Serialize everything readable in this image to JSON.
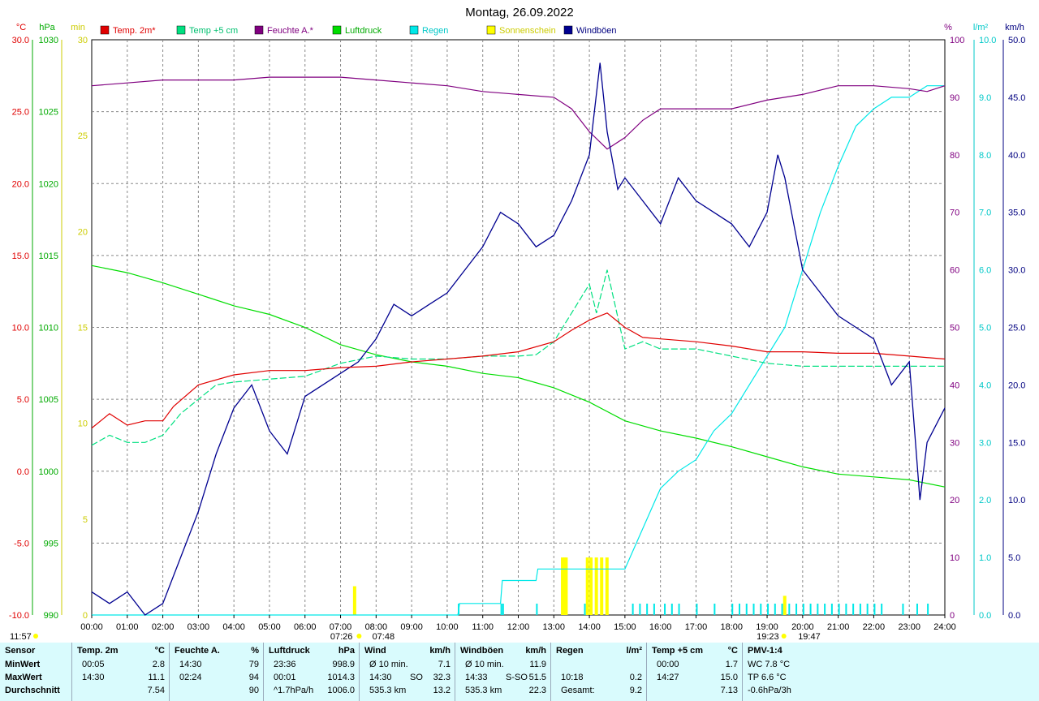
{
  "title": "Montag, 26.09.2022",
  "colors": {
    "temp2m": "#e00000",
    "temp5cm": "#00e080",
    "humidity": "#800080",
    "pressure": "#00dd00",
    "rain": "#00e8e8",
    "sunshine": "#ffff00",
    "gusts": "#000090"
  },
  "chart_data": {
    "type": "line",
    "title": "Montag, 26.09.2022",
    "x_ticks": [
      "00:00",
      "01:00",
      "02:00",
      "03:00",
      "04:00",
      "05:00",
      "06:00",
      "07:00",
      "08:00",
      "09:00",
      "10:00",
      "11:00",
      "12:00",
      "13:00",
      "14:00",
      "15:00",
      "16:00",
      "17:00",
      "18:00",
      "19:00",
      "20:00",
      "21:00",
      "22:00",
      "23:00",
      "24:00"
    ],
    "axes": {
      "temp": {
        "unit": "°C",
        "ticks": [
          "30.0",
          "25.0",
          "20.0",
          "15.0",
          "10.0",
          "5.0",
          "0.0",
          "-5.0",
          "-10.0"
        ],
        "range": [
          -10,
          30
        ]
      },
      "pressure": {
        "unit": "hPa",
        "ticks": [
          "1030",
          "1025",
          "1020",
          "1015",
          "1010",
          "1005",
          "1000",
          "995",
          "990"
        ],
        "range": [
          990,
          1030
        ]
      },
      "sunshine": {
        "unit": "min",
        "ticks": [
          "30",
          "25",
          "20",
          "15",
          "10",
          "5",
          "0"
        ],
        "range": [
          0,
          30
        ]
      },
      "humidity": {
        "unit": "%",
        "ticks": [
          "100",
          "90",
          "80",
          "70",
          "60",
          "50",
          "40",
          "30",
          "20",
          "10",
          "0"
        ],
        "range": [
          0,
          100
        ]
      },
      "rain": {
        "unit": "l/m²",
        "ticks": [
          "10.0",
          "9.0",
          "8.0",
          "7.0",
          "6.0",
          "5.0",
          "4.0",
          "3.0",
          "2.0",
          "1.0",
          "0.0"
        ],
        "range": [
          0,
          10
        ]
      },
      "wind": {
        "unit": "km/h",
        "ticks": [
          "50.0",
          "45.0",
          "40.0",
          "35.0",
          "30.0",
          "25.0",
          "20.0",
          "15.0",
          "10.0",
          "5.0",
          "0.0"
        ],
        "range": [
          0,
          50
        ]
      }
    },
    "legend": [
      "Temp. 2m*",
      "Temp +5 cm",
      "Feuchte A.*",
      "Luftdruck",
      "Regen",
      "Sonnenschein",
      "Windböen"
    ],
    "series": [
      {
        "name": "Temp. 2m*",
        "axis": "temp",
        "x": [
          0,
          0.5,
          1,
          1.5,
          2,
          2.3,
          3,
          4,
          5,
          6,
          7,
          8,
          9,
          10,
          11,
          12,
          13,
          13.5,
          14,
          14.5,
          15,
          15.5,
          16,
          17,
          18,
          19,
          20,
          21,
          22,
          23,
          24
        ],
        "y": [
          3.0,
          4.0,
          3.2,
          3.5,
          3.5,
          4.5,
          6.0,
          6.7,
          7.0,
          7.0,
          7.2,
          7.3,
          7.6,
          7.8,
          8.0,
          8.3,
          9.0,
          9.8,
          10.5,
          11.0,
          10.0,
          9.3,
          9.2,
          9.0,
          8.7,
          8.3,
          8.3,
          8.2,
          8.2,
          8.0,
          7.8
        ]
      },
      {
        "name": "Temp +5 cm",
        "axis": "temp",
        "x": [
          0,
          0.5,
          1,
          1.5,
          2,
          2.5,
          3,
          3.5,
          4,
          5,
          6,
          7,
          8,
          9,
          10,
          11,
          12,
          12.5,
          13,
          13.5,
          14,
          14.2,
          14.5,
          15,
          15.5,
          16,
          17,
          18,
          19,
          20,
          21,
          22,
          23,
          24
        ],
        "y": [
          1.8,
          2.5,
          2.0,
          2.0,
          2.5,
          4.0,
          5.0,
          6.0,
          6.2,
          6.4,
          6.6,
          7.5,
          8.0,
          7.8,
          7.8,
          8.0,
          8.0,
          8.1,
          9.0,
          11.0,
          13.0,
          11.0,
          14.0,
          8.5,
          9.0,
          8.5,
          8.5,
          8.0,
          7.5,
          7.3,
          7.3,
          7.3,
          7.3,
          7.3
        ]
      },
      {
        "name": "Feuchte A.*",
        "axis": "humidity",
        "x": [
          0,
          1,
          2,
          3,
          4,
          5,
          6,
          7,
          8,
          9,
          10,
          11,
          12,
          13,
          13.5,
          14,
          14.5,
          15,
          15.5,
          16,
          17,
          18,
          19,
          20,
          21,
          22,
          23,
          23.5,
          24
        ],
        "y": [
          92,
          92.5,
          93,
          93,
          93,
          93.5,
          93.5,
          93.5,
          93,
          92.5,
          92,
          91,
          90.5,
          90,
          88,
          84,
          81,
          83,
          86,
          88,
          88,
          88,
          89.5,
          90.5,
          92,
          92,
          91.5,
          91,
          92
        ]
      },
      {
        "name": "Luftdruck",
        "axis": "pressure",
        "x": [
          0,
          1,
          2,
          3,
          4,
          5,
          6,
          7,
          8,
          9,
          10,
          11,
          12,
          13,
          14,
          15,
          16,
          17,
          18,
          19,
          20,
          21,
          22,
          23,
          24
        ],
        "y": [
          1014.3,
          1013.8,
          1013.1,
          1012.3,
          1011.5,
          1010.9,
          1010.0,
          1008.8,
          1008.1,
          1007.6,
          1007.3,
          1006.8,
          1006.5,
          1005.8,
          1004.8,
          1003.5,
          1002.8,
          1002.3,
          1001.7,
          1001.0,
          1000.3,
          999.8,
          999.6,
          999.4,
          998.9
        ]
      },
      {
        "name": "Regen",
        "axis": "rain",
        "x": [
          0,
          10.3,
          10.35,
          11.5,
          11.55,
          12.5,
          12.55,
          13.8,
          13.85,
          15.0,
          15.5,
          16.0,
          16.5,
          17.0,
          17.5,
          18.0,
          18.5,
          19.0,
          19.5,
          20.0,
          20.5,
          21.0,
          21.5,
          22.0,
          22.5,
          23.0,
          23.5,
          24.0
        ],
        "y": [
          0,
          0,
          0.2,
          0.2,
          0.6,
          0.6,
          0.8,
          0.8,
          0.8,
          0.8,
          1.5,
          2.2,
          2.5,
          2.7,
          3.2,
          3.5,
          4.0,
          4.5,
          5.0,
          6.0,
          7.0,
          7.8,
          8.5,
          8.8,
          9.0,
          9.0,
          9.2,
          9.2
        ]
      },
      {
        "name": "Sonnenschein",
        "axis": "sunshine",
        "bars": [
          [
            7.35,
            1.5
          ],
          [
            13.2,
            3
          ],
          [
            13.25,
            3
          ],
          [
            13.3,
            3
          ],
          [
            13.9,
            3
          ],
          [
            14.0,
            3
          ],
          [
            14.15,
            3
          ],
          [
            14.3,
            3
          ],
          [
            14.45,
            3
          ],
          [
            19.45,
            1
          ]
        ]
      },
      {
        "name": "Windböen",
        "axis": "wind",
        "x": [
          0,
          0.5,
          1,
          1.5,
          2,
          2.5,
          3,
          3.5,
          4,
          4.5,
          5,
          5.5,
          6,
          6.5,
          7,
          7.5,
          8,
          8.5,
          9,
          9.5,
          10,
          10.5,
          11,
          11.5,
          12,
          12.5,
          13,
          13.5,
          14,
          14.3,
          14.5,
          14.8,
          15,
          15.5,
          16,
          16.5,
          17,
          17.5,
          18,
          18.5,
          19,
          19.3,
          19.5,
          20,
          20.5,
          21,
          21.5,
          22,
          22.5,
          23,
          23.3,
          23.5,
          24
        ],
        "y": [
          2,
          1,
          2,
          0,
          1,
          5,
          9,
          14,
          18,
          20,
          16,
          14,
          19,
          20,
          21,
          22,
          24,
          27,
          26,
          27,
          28,
          30,
          32,
          35,
          34,
          32,
          33,
          36,
          40,
          48,
          42,
          37,
          38,
          36,
          34,
          38,
          36,
          35,
          34,
          32,
          35,
          40,
          38,
          30,
          28,
          26,
          25,
          24,
          20,
          22,
          10,
          15,
          18
        ]
      }
    ],
    "rain_ticks_x": [
      10.3,
      11.5,
      11.55,
      12.5,
      13.85,
      15.2,
      15.4,
      15.6,
      15.8,
      16.1,
      16.3,
      16.5,
      17.0,
      17.5,
      18.0,
      18.2,
      18.4,
      18.6,
      18.8,
      19.0,
      19.2,
      19.4,
      19.6,
      19.8,
      20.0,
      20.2,
      20.4,
      20.6,
      20.8,
      21.0,
      21.2,
      21.4,
      21.6,
      21.8,
      22.0,
      22.2,
      22.8,
      23.2,
      23.5
    ],
    "sunrise": {
      "time": "07:26",
      "noon": "07:48"
    },
    "sunset": {
      "time": "19:23",
      "noon": "19:47"
    },
    "bottom_left_label": "11:57"
  },
  "stats": {
    "sensor": {
      "header": "Sensor",
      "rows": [
        "MinWert",
        "MaxWert",
        "Durchschnitt"
      ]
    },
    "temp2m": {
      "header": "Temp. 2m",
      "unit": "°C",
      "rows": [
        [
          "00:05",
          "2.8"
        ],
        [
          "14:30",
          "11.1"
        ],
        [
          "",
          "7.54"
        ]
      ]
    },
    "humidity": {
      "header": "Feuchte A.",
      "unit": "%",
      "rows": [
        [
          "14:30",
          "79"
        ],
        [
          "02:24",
          "94"
        ],
        [
          "",
          "90"
        ]
      ]
    },
    "pressure": {
      "header": "Luftdruck",
      "unit": "hPa",
      "rows": [
        [
          "23:36",
          "998.9"
        ],
        [
          "00:01",
          "1014.3"
        ],
        [
          "^1.7hPa/h",
          "1006.0"
        ]
      ]
    },
    "wind": {
      "header": "Wind",
      "unit": "km/h",
      "rows": [
        [
          "Ø 10 min.",
          "",
          "7.1"
        ],
        [
          "14:30",
          "SO",
          "32.3"
        ],
        [
          "535.3 km",
          "",
          "13.2"
        ]
      ]
    },
    "gusts": {
      "header": "Windböen",
      "unit": "km/h",
      "rows": [
        [
          "Ø 10 min.",
          "",
          "11.9"
        ],
        [
          "14:33",
          "S-SO",
          "51.5"
        ],
        [
          "535.3 km",
          "",
          "22.3"
        ]
      ]
    },
    "rain": {
      "header": "Regen",
      "unit": "l/m²",
      "rows": [
        [
          "",
          ""
        ],
        [
          "10:18",
          "0.2"
        ],
        [
          "Gesamt:",
          "9.2"
        ]
      ]
    },
    "temp5cm": {
      "header": "Temp +5 cm",
      "unit": "°C",
      "rows": [
        [
          "00:00",
          "1.7"
        ],
        [
          "14:27",
          "15.0"
        ],
        [
          "",
          "7.13"
        ]
      ]
    },
    "pmv": {
      "header": "PMV-1:4",
      "rows": [
        "WC 7.8 °C",
        "TP 6.6 °C",
        "-0.6hPa/3h"
      ]
    }
  }
}
